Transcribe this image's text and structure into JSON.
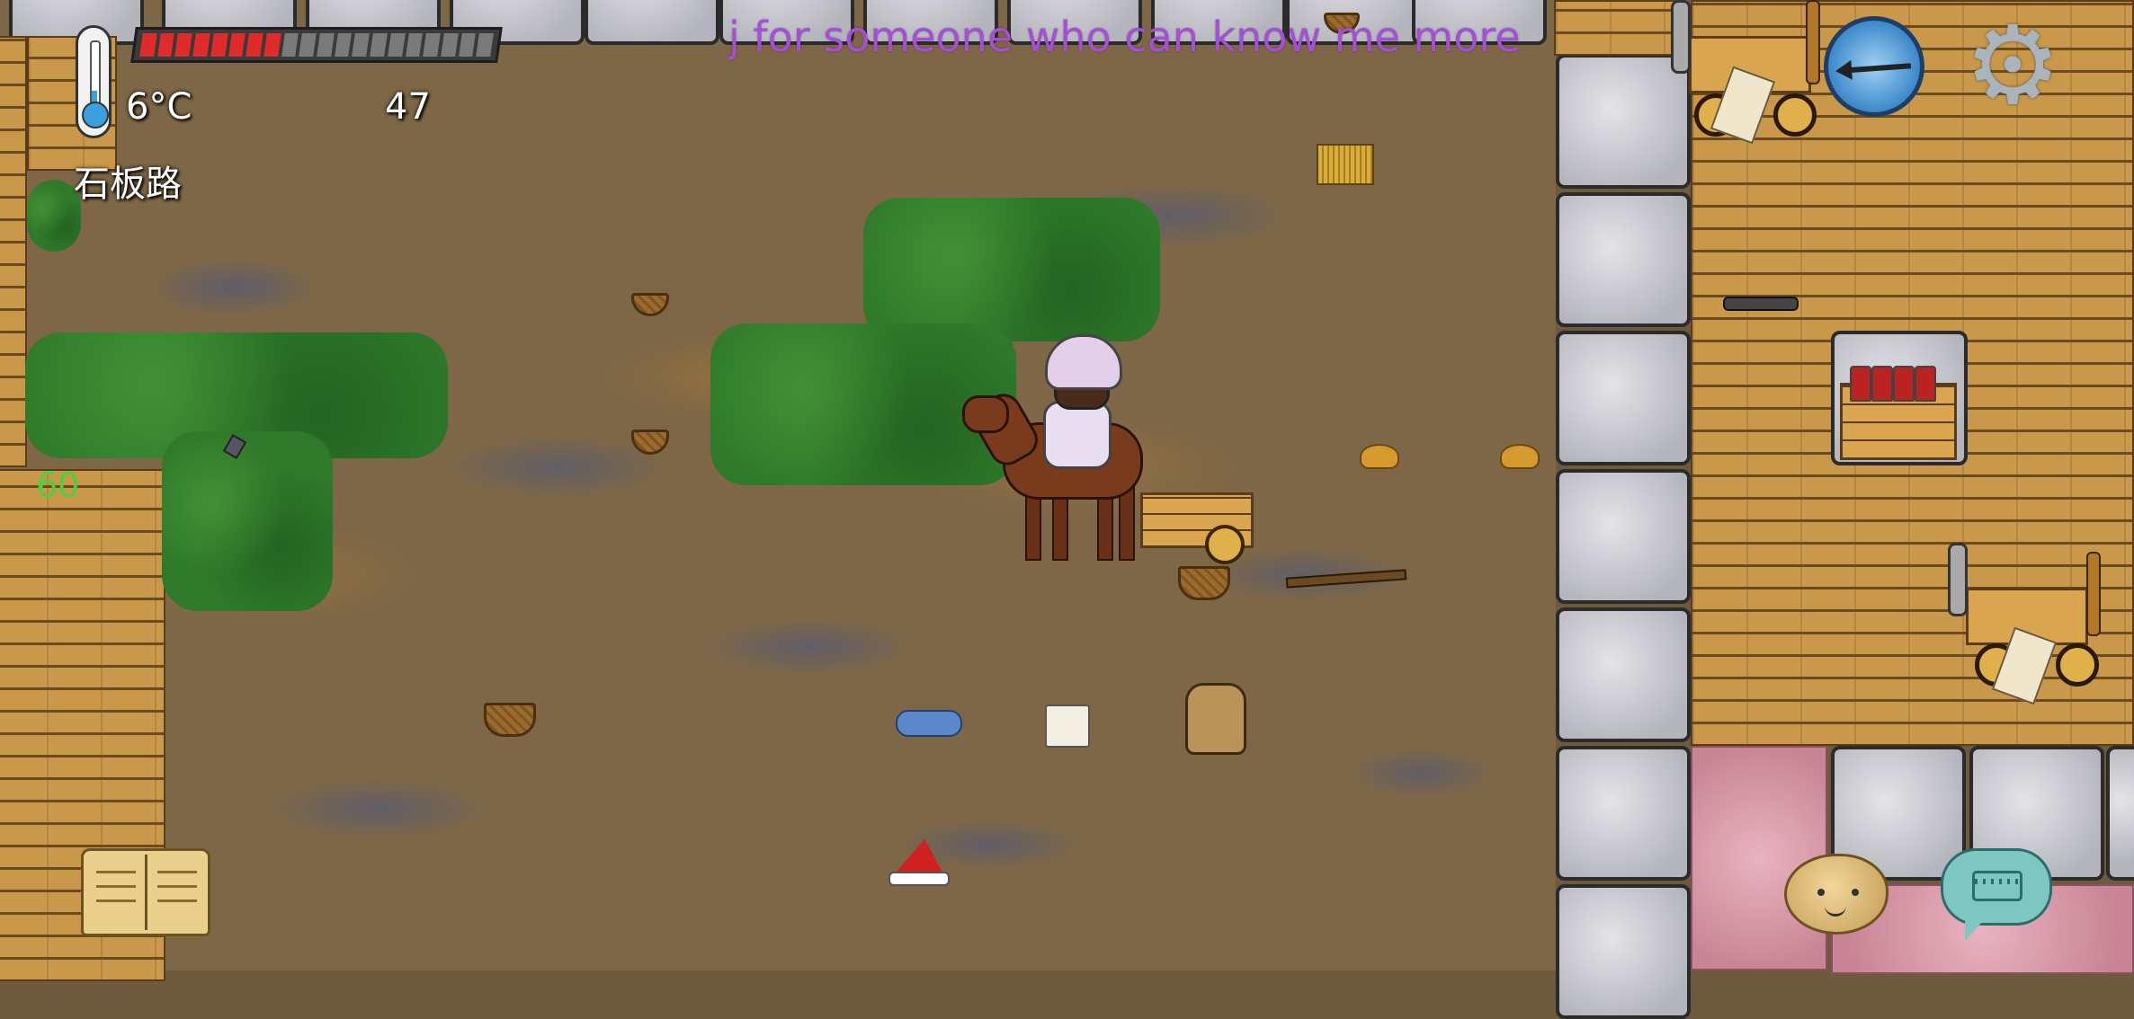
{
  "hud": {
    "temperature": "6°C",
    "food_pips_total": 20,
    "food_pips_filled": 8,
    "age": "47",
    "biome_label": "石板路",
    "yum_counter": "60"
  },
  "message": {
    "text": "j for someone who can know me more",
    "color": "#a44fd6"
  },
  "controls": {
    "compass": "compass-icon",
    "settings": "gear-icon",
    "tech_book": "book-icon",
    "emote": "potato-face-icon",
    "chat": "keyboard-icon"
  },
  "colors": {
    "health_red": "#e02b2b",
    "grass": "#2f7a2a",
    "yum_green": "#4bd13c"
  },
  "world": {
    "ground_items": [
      "basket",
      "basket",
      "basket",
      "basket",
      "grain-pile",
      "grain-pile",
      "wheat-sheaf",
      "cloth",
      "shorts",
      "backpack",
      "santa-hat",
      "branch",
      "flint",
      "horse-cart",
      "crate-with-jars",
      "propeller-plane",
      "propeller-plane",
      "wheel-part"
    ]
  }
}
